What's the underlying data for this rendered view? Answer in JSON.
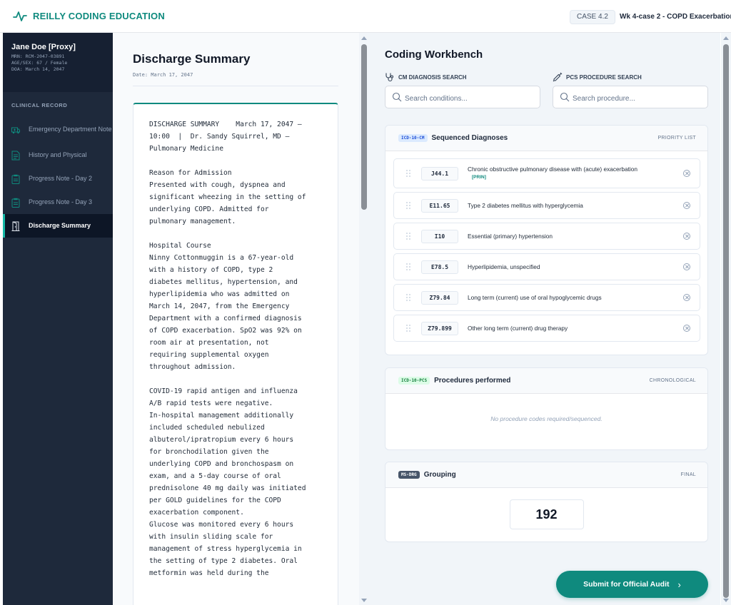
{
  "header": {
    "brand": "REILLY CODING EDUCATION",
    "brand_icon": "pulse-icon",
    "case_badge": "CASE 4.2",
    "case_title": "Wk 4-case 2 - COPD Exacerbation"
  },
  "patient": {
    "name": "Jane Doe [Proxy]",
    "mrn": "MRN: RCM-2047-03891",
    "age_sex": "AGE/SEX: 67 / Female",
    "doa": "DOA: March 14, 2047"
  },
  "sidebar": {
    "section_label": "CLINICAL RECORD",
    "items": [
      {
        "label": "Emergency Department Note",
        "icon": "ambulance-icon",
        "active": false
      },
      {
        "label": "History and Physical",
        "icon": "document-icon",
        "active": false
      },
      {
        "label": "Progress Note - Day 2",
        "icon": "clipboard-icon",
        "active": false
      },
      {
        "label": "Progress Note - Day 3",
        "icon": "clipboard-icon",
        "active": false
      },
      {
        "label": "Discharge Summary",
        "icon": "door-exit-icon",
        "active": true
      }
    ]
  },
  "document": {
    "title": "Discharge Summary",
    "date": "Date: March 17, 2047",
    "body": "DISCHARGE SUMMARY    March 17, 2047 —\n10:00  |  Dr. Sandy Squirrel, MD —\nPulmonary Medicine\n\nReason for Admission\nPresented with cough, dyspnea and\nsignificant wheezing in the setting of\nunderlying COPD. Admitted for\npulmonary management.\n\nHospital Course\nNinny Cottonmuggin is a 67-year-old\nwith a history of COPD, type 2\ndiabetes mellitus, hypertension, and\nhyperlipidemia who was admitted on\nMarch 14, 2047, from the Emergency\nDepartment with a confirmed diagnosis\nof COPD exacerbation. SpO2 was 92% on\nroom air at presentation, not\nrequiring supplemental oxygen\nthroughout admission.\n\nCOVID-19 rapid antigen and influenza\nA/B rapid tests were negative.\nIn-hospital management additionally\nincluded scheduled nebulized\nalbuterol/ipratropium every 6 hours\nfor bronchodilation given the\nunderlying COPD and bronchospasm on\nexam, and a 5-day course of oral\nprednisolone 40 mg daily was initiated\nper GOLD guidelines for the COPD\nexacerbation component.\nGlucose was monitored every 6 hours\nwith insulin sliding scale for\nmanagement of stress hyperglycemia in\nthe setting of type 2 diabetes. Oral\nmetformin was held during the"
  },
  "workbench": {
    "title": "Coding Workbench",
    "cm_search": {
      "label": "CM DIAGNOSIS SEARCH",
      "icon": "stethoscope-icon",
      "placeholder": "Search conditions...",
      "value": ""
    },
    "pcs_search": {
      "label": "PCS PROCEDURE SEARCH",
      "icon": "syringe-icon",
      "placeholder": "Search procedure...",
      "value": ""
    },
    "diagnoses": {
      "tag": "ICD-10-CM",
      "title": "Sequenced Diagnoses",
      "right_label": "PRIORITY LIST",
      "rows": [
        {
          "code": "J44.1",
          "desc": "Chronic obstructive pulmonary disease with (acute) exacerbation",
          "flag": "[PRIN]"
        },
        {
          "code": "E11.65",
          "desc": "Type 2 diabetes mellitus with hyperglycemia",
          "flag": ""
        },
        {
          "code": "I10",
          "desc": "Essential (primary) hypertension",
          "flag": ""
        },
        {
          "code": "E78.5",
          "desc": "Hyperlipidemia, unspecified",
          "flag": ""
        },
        {
          "code": "Z79.84",
          "desc": "Long term (current) use of oral hypoglycemic drugs",
          "flag": ""
        },
        {
          "code": "Z79.899",
          "desc": "Other long term (current) drug therapy",
          "flag": ""
        }
      ]
    },
    "procedures": {
      "tag": "ICD-10-PCS",
      "title": "Procedures performed",
      "right_label": "CHRONOLOGICAL",
      "empty": "No procedure codes required/sequenced."
    },
    "grouping": {
      "tag": "MS-DRG",
      "title": "Grouping",
      "right_label": "FINAL",
      "value": "192"
    },
    "submit_label": "Submit for Official Audit",
    "submit_icon": "chevron-right-icon"
  },
  "colors": {
    "accent": "#0f8a7e",
    "sidebar_bg": "#1e293b",
    "workbench_bg": "#f1f5f9"
  }
}
